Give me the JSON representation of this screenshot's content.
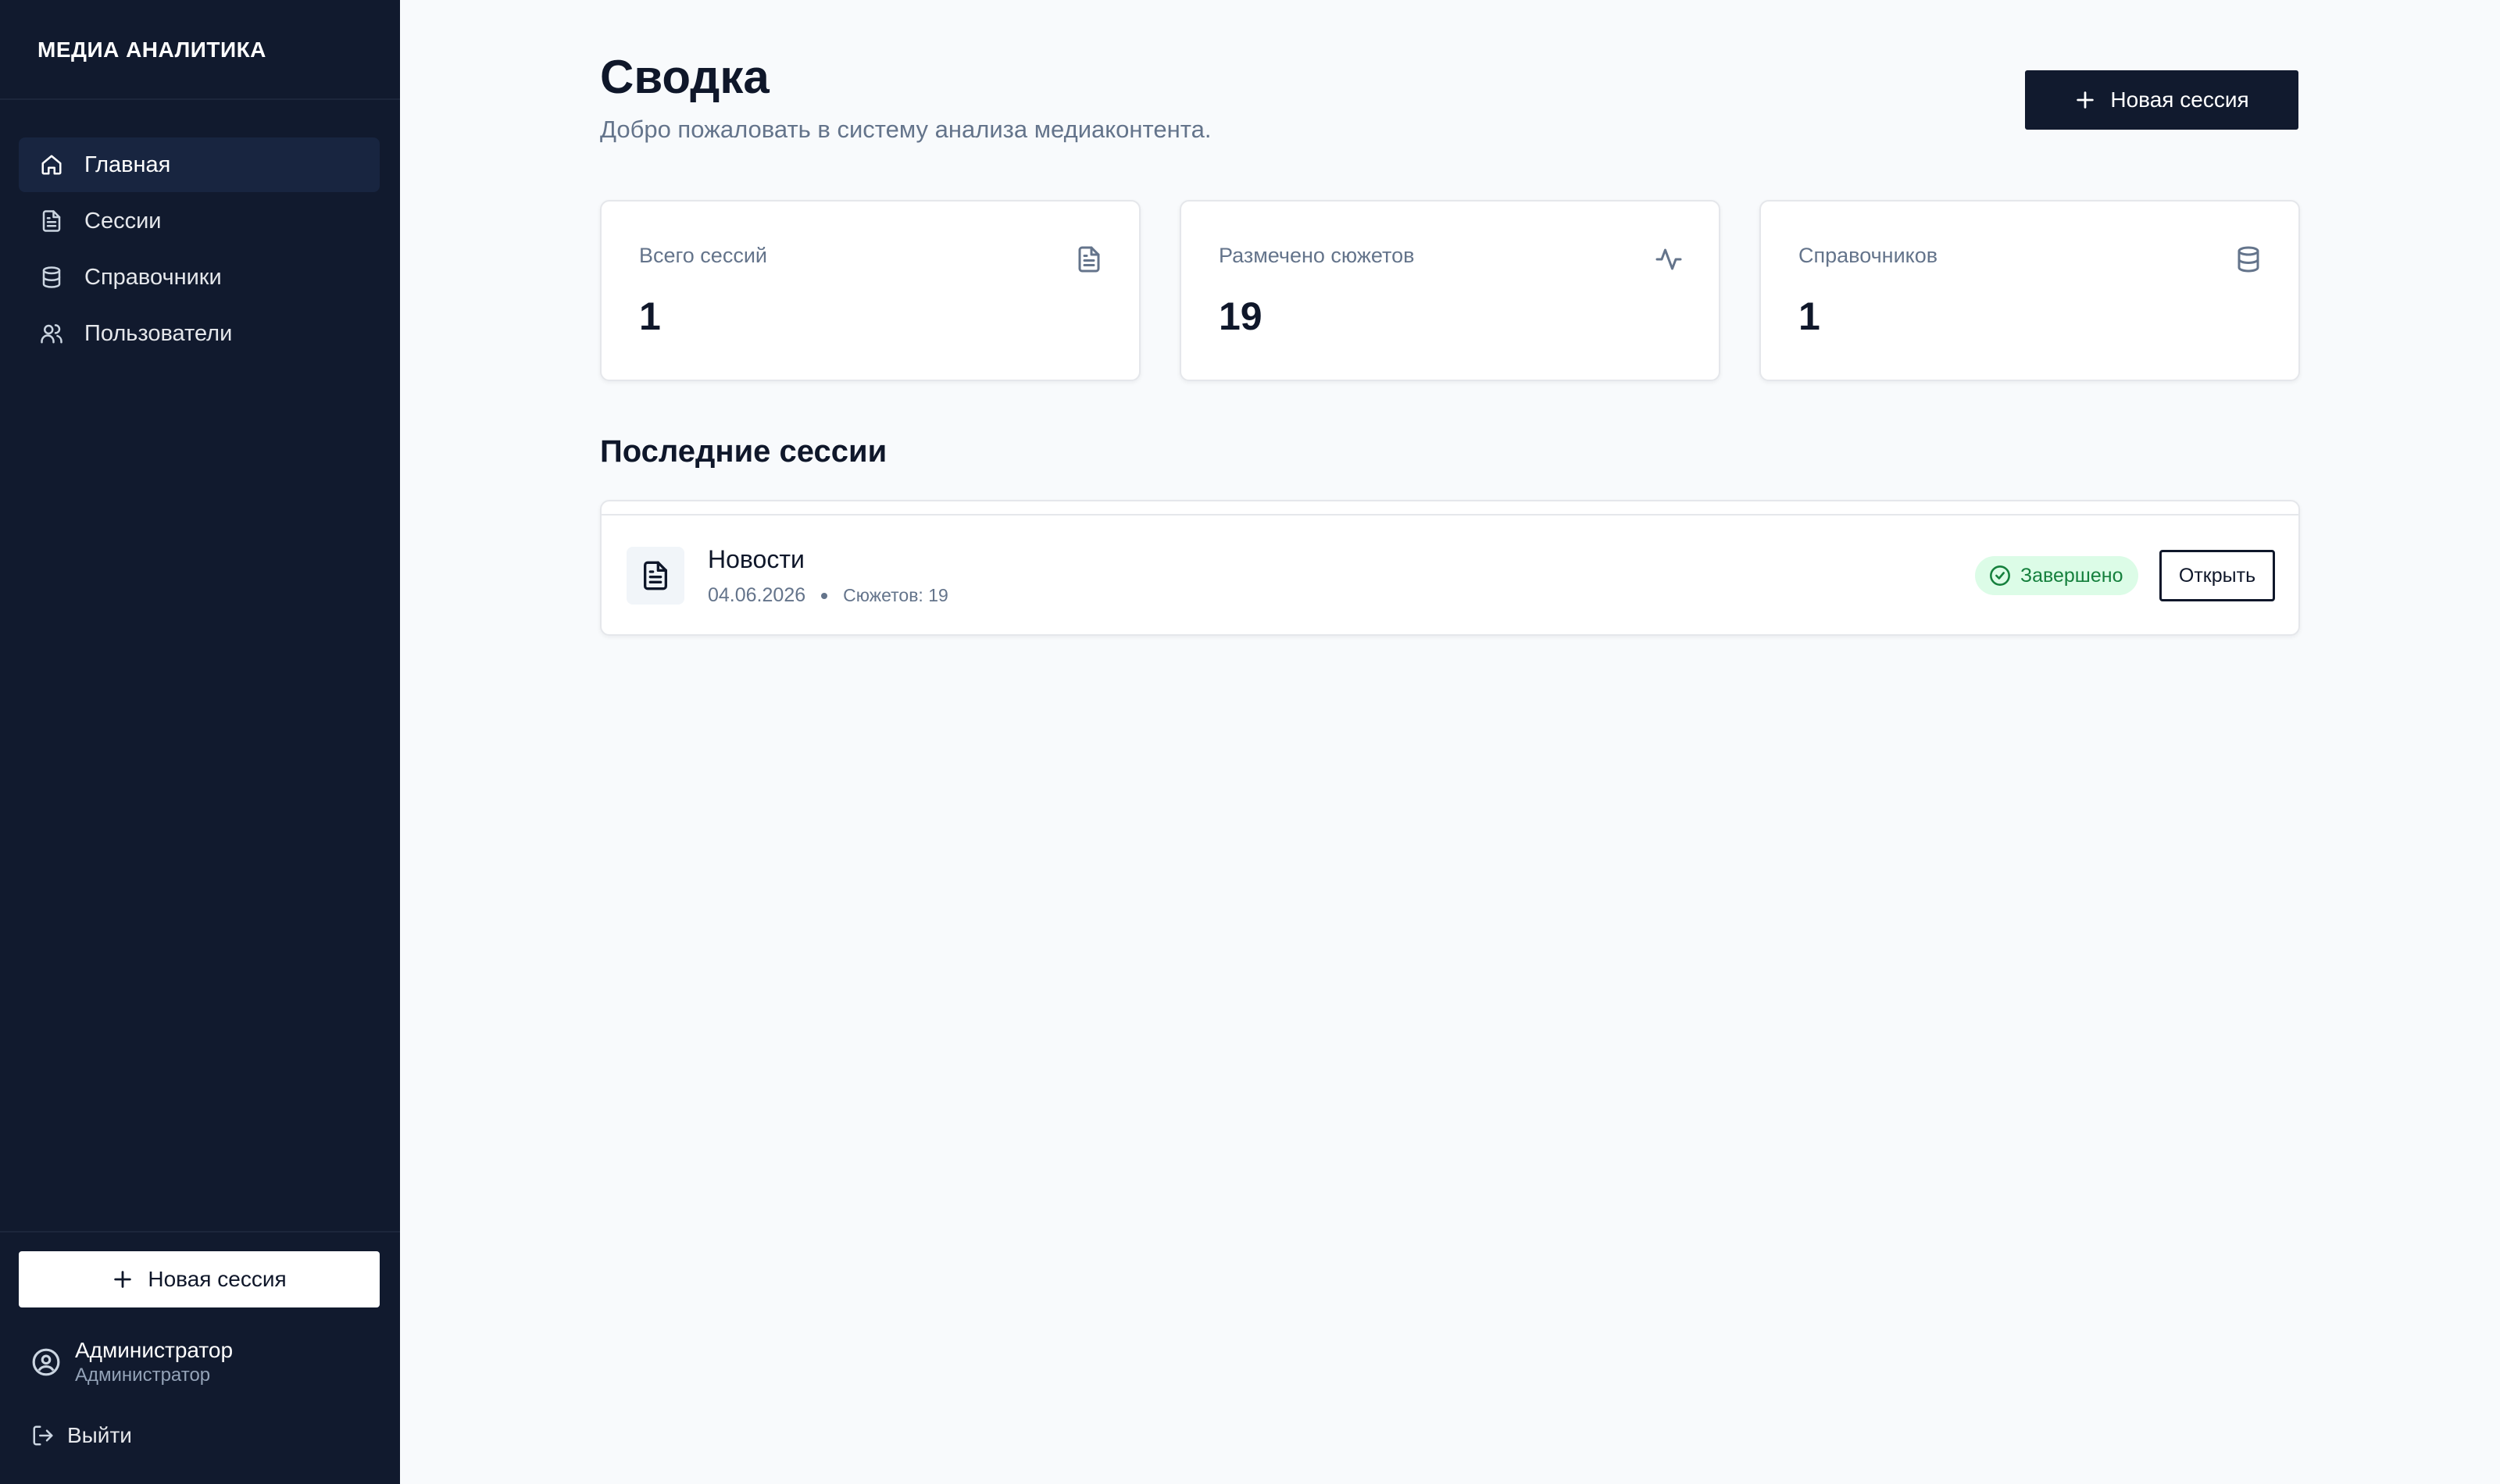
{
  "sidebar": {
    "brand": "МЕДИА АНАЛИТИКА",
    "items": [
      {
        "label": "Главная",
        "icon": "home-icon",
        "active": true
      },
      {
        "label": "Сессии",
        "icon": "file-text-icon",
        "active": false
      },
      {
        "label": "Справочники",
        "icon": "database-icon",
        "active": false
      },
      {
        "label": "Пользователи",
        "icon": "users-icon",
        "active": false
      }
    ],
    "new_session_label": "Новая сессия",
    "user": {
      "name": "Администратор",
      "role": "Администратор",
      "icon": "user-circle-icon"
    },
    "logout_label": "Выйти"
  },
  "header": {
    "title": "Сводка",
    "subtitle": "Добро пожаловать в систему анализа медиаконтента.",
    "new_session_label": "Новая сессия"
  },
  "stats": [
    {
      "label": "Всего сессий",
      "value": "1",
      "icon": "file-text-icon"
    },
    {
      "label": "Размечено сюжетов",
      "value": "19",
      "icon": "activity-icon"
    },
    {
      "label": "Справочников",
      "value": "1",
      "icon": "database-icon"
    }
  ],
  "recent": {
    "title": "Последние сессии",
    "sessions": [
      {
        "name": "Новости",
        "date": "04.06.2026",
        "count": "Сюжетов: 19",
        "status": "Завершено",
        "open_label": "Открыть"
      }
    ]
  },
  "colors": {
    "sidebar_bg": "#111a2e",
    "accent": "#111a2e",
    "status_success_bg": "#dcfce7",
    "status_success_fg": "#15803d"
  }
}
